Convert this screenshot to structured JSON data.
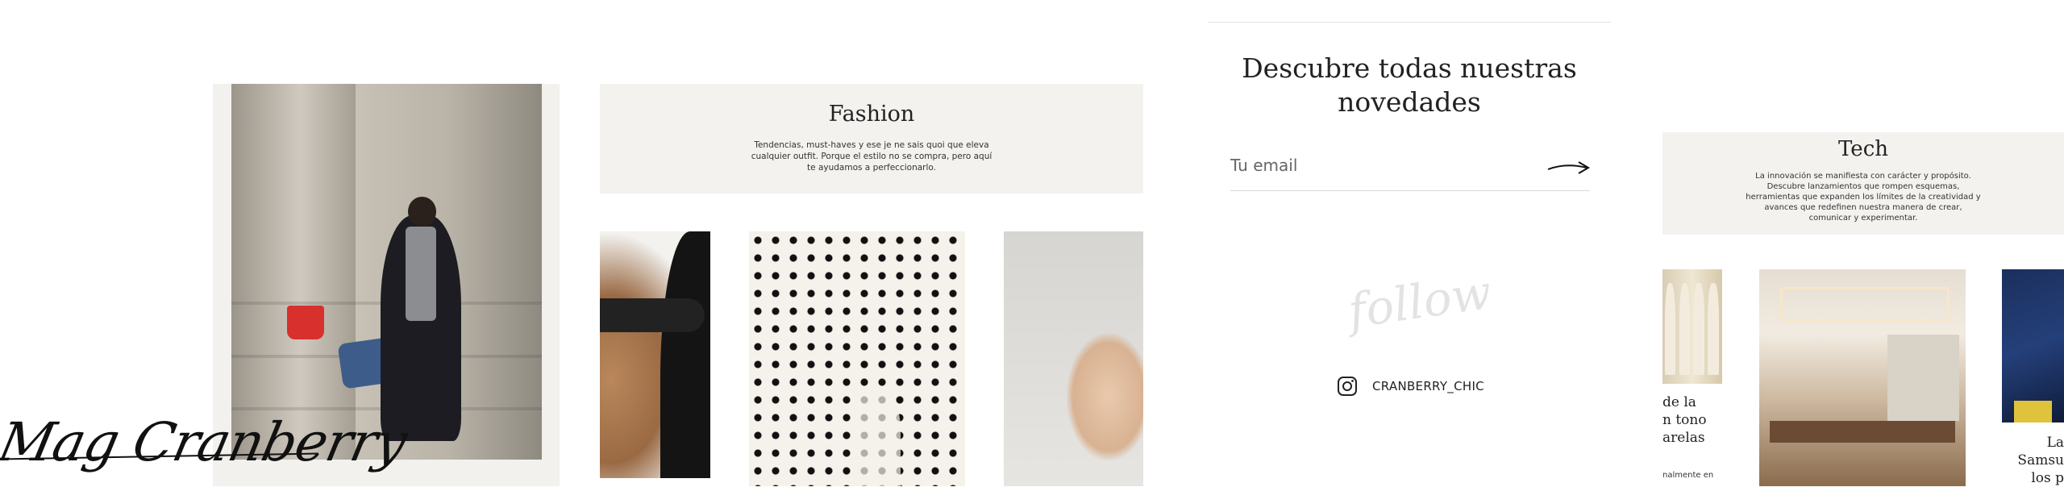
{
  "signature": {
    "text": "Mag Cranberry"
  },
  "fashion": {
    "title": "Fashion",
    "description": "Tendencias, must-haves y ese je ne sais quoi que eleva cualquier outfit. Porque el estilo no se compra, pero aquí te ayudamos a perfeccionarlo."
  },
  "newsletter": {
    "title": "Descubre todas nuestras novedades",
    "email_placeholder": "Tu email"
  },
  "follow": {
    "script_word": "follow",
    "instagram_handle": "CRANBERRY_CHIC"
  },
  "tech": {
    "title": "Tech",
    "description": "La innovación se manifiesta con carácter y propósito. Descubre lanzamientos que rompen esquemas, herramientas que expanden los límites de la creatividad y avances que redefinen nuestra manera de crear, comunicar y experimentar.",
    "snippet_left": "de la\nn tono\narelas",
    "snippet_left_small": "nalmente en",
    "snippet_right": "La\nSamsu\nlos p"
  }
}
